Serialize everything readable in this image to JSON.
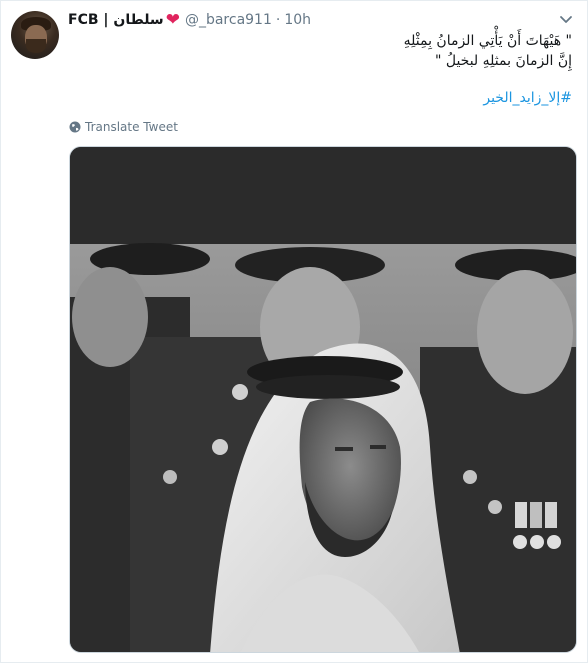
{
  "tweet": {
    "display_name": "FCB | سلطان",
    "heart_glyph": "❤",
    "handle": "@_barca911",
    "separator": "·",
    "time": "10h",
    "lines": [
      "\" هَيْهَاتَ أَنْ يَأْتِي الزمانُ بِمِثْلِهِ",
      "إِنَّ الزمانَ بمثلِهِ لبخيلُ \""
    ],
    "hashtag": "#إلا_زايد_الخير",
    "translate_label": "Translate Tweet"
  },
  "icons": {
    "more": "chevron-down-icon",
    "translate": "globe-icon"
  },
  "colors": {
    "link": "#1b95e0",
    "secondary": "#657786",
    "heart": "#e0245e"
  }
}
